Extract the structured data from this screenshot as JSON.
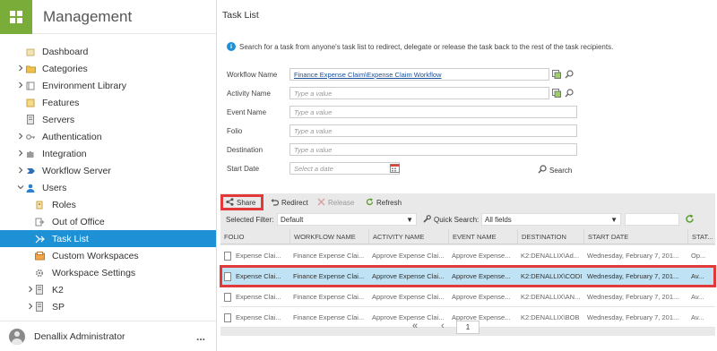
{
  "app": {
    "title": "Management"
  },
  "colors": {
    "brand": "#7aac3a",
    "accent": "#1e90d6",
    "highlight": "#e23a3a",
    "selected_row": "#bfe2f4"
  },
  "sidebar": {
    "items": [
      {
        "label": "Dashboard",
        "icon": "dashboard-icon",
        "expandable": false
      },
      {
        "label": "Categories",
        "icon": "folder-icon",
        "expandable": true
      },
      {
        "label": "Environment Library",
        "icon": "library-icon",
        "expandable": true
      },
      {
        "label": "Features",
        "icon": "features-icon",
        "expandable": false
      },
      {
        "label": "Servers",
        "icon": "server-icon",
        "expandable": false
      },
      {
        "label": "Authentication",
        "icon": "key-icon",
        "expandable": true
      },
      {
        "label": "Integration",
        "icon": "puzzle-icon",
        "expandable": true
      },
      {
        "label": "Workflow Server",
        "icon": "workflow-icon",
        "expandable": true
      },
      {
        "label": "Users",
        "icon": "user-icon",
        "expandable": true,
        "expanded": true
      },
      {
        "label": "Roles",
        "icon": "roles-icon",
        "sub": true
      },
      {
        "label": "Out of Office",
        "icon": "out-of-office-icon",
        "sub": true
      },
      {
        "label": "Task List",
        "icon": "task-list-icon",
        "sub": true,
        "selected": true
      },
      {
        "label": "Custom Workspaces",
        "icon": "inbox-icon",
        "sub": true
      },
      {
        "label": "Workspace Settings",
        "icon": "gear-icon",
        "sub": true
      },
      {
        "label": "K2",
        "icon": "server-icon",
        "sub": true,
        "expandable": true
      },
      {
        "label": "SP",
        "icon": "server-icon",
        "sub": true,
        "expandable": true
      }
    ],
    "user": "Denallix Administrator",
    "more": "..."
  },
  "main": {
    "title": "Task List",
    "info": "Search for a task from anyone's task list to redirect, delegate or release the task back to the rest of the task recipients.",
    "form": {
      "workflow_name": {
        "label": "Workflow Name",
        "value": "Finance Expense Claim\\Expense Claim Workflow"
      },
      "activity_name": {
        "label": "Activity Name",
        "placeholder": "Type a value"
      },
      "event_name": {
        "label": "Event Name",
        "placeholder": "Type a value"
      },
      "folio": {
        "label": "Folio",
        "placeholder": "Type a value"
      },
      "destination": {
        "label": "Destination",
        "placeholder": "Type a value"
      },
      "start_date": {
        "label": "Start Date",
        "placeholder": "Select a date"
      },
      "search": "Search"
    },
    "toolbar": {
      "share": "Share",
      "redirect": "Redirect",
      "release": "Release",
      "refresh": "Refresh"
    },
    "filter": {
      "label": "Selected Filter:",
      "value": "Default",
      "qs_label": "Quick Search:",
      "qs_value": "All fields"
    },
    "table": {
      "columns": [
        "FOLIO",
        "WORKFLOW NAME",
        "ACTIVITY NAME",
        "EVENT NAME",
        "DESTINATION",
        "START DATE",
        "STAT..."
      ],
      "rows": [
        [
          "Expense Clai...",
          "Finance Expense Clai...",
          "Approve Expense Clai...",
          "Approve Expense...",
          "K2:DENALLIX\\Ad...",
          "Wednesday, February 7, 201...",
          "Op..."
        ],
        [
          "Expense Clai...",
          "Finance Expense Clai...",
          "Approve Expense Clai...",
          "Approve Expense...",
          "K2:DENALLIX\\CODI",
          "Wednesday, February 7, 201...",
          "Av..."
        ],
        [
          "Expense Clai...",
          "Finance Expense Clai...",
          "Approve Expense Clai...",
          "Approve Expense...",
          "K2:DENALLIX\\AN...",
          "Wednesday, February 7, 201...",
          "Av..."
        ],
        [
          "Expense Clai...",
          "Finance Expense Clai...",
          "Approve Expense Clai...",
          "Approve Expense...",
          "K2:DENALLIX\\BOB",
          "Wednesday, February 7, 201...",
          "Av..."
        ]
      ],
      "selected_row": 1
    },
    "pager": {
      "page": "1",
      "first": "«",
      "prev": "‹",
      "next": "›"
    }
  }
}
